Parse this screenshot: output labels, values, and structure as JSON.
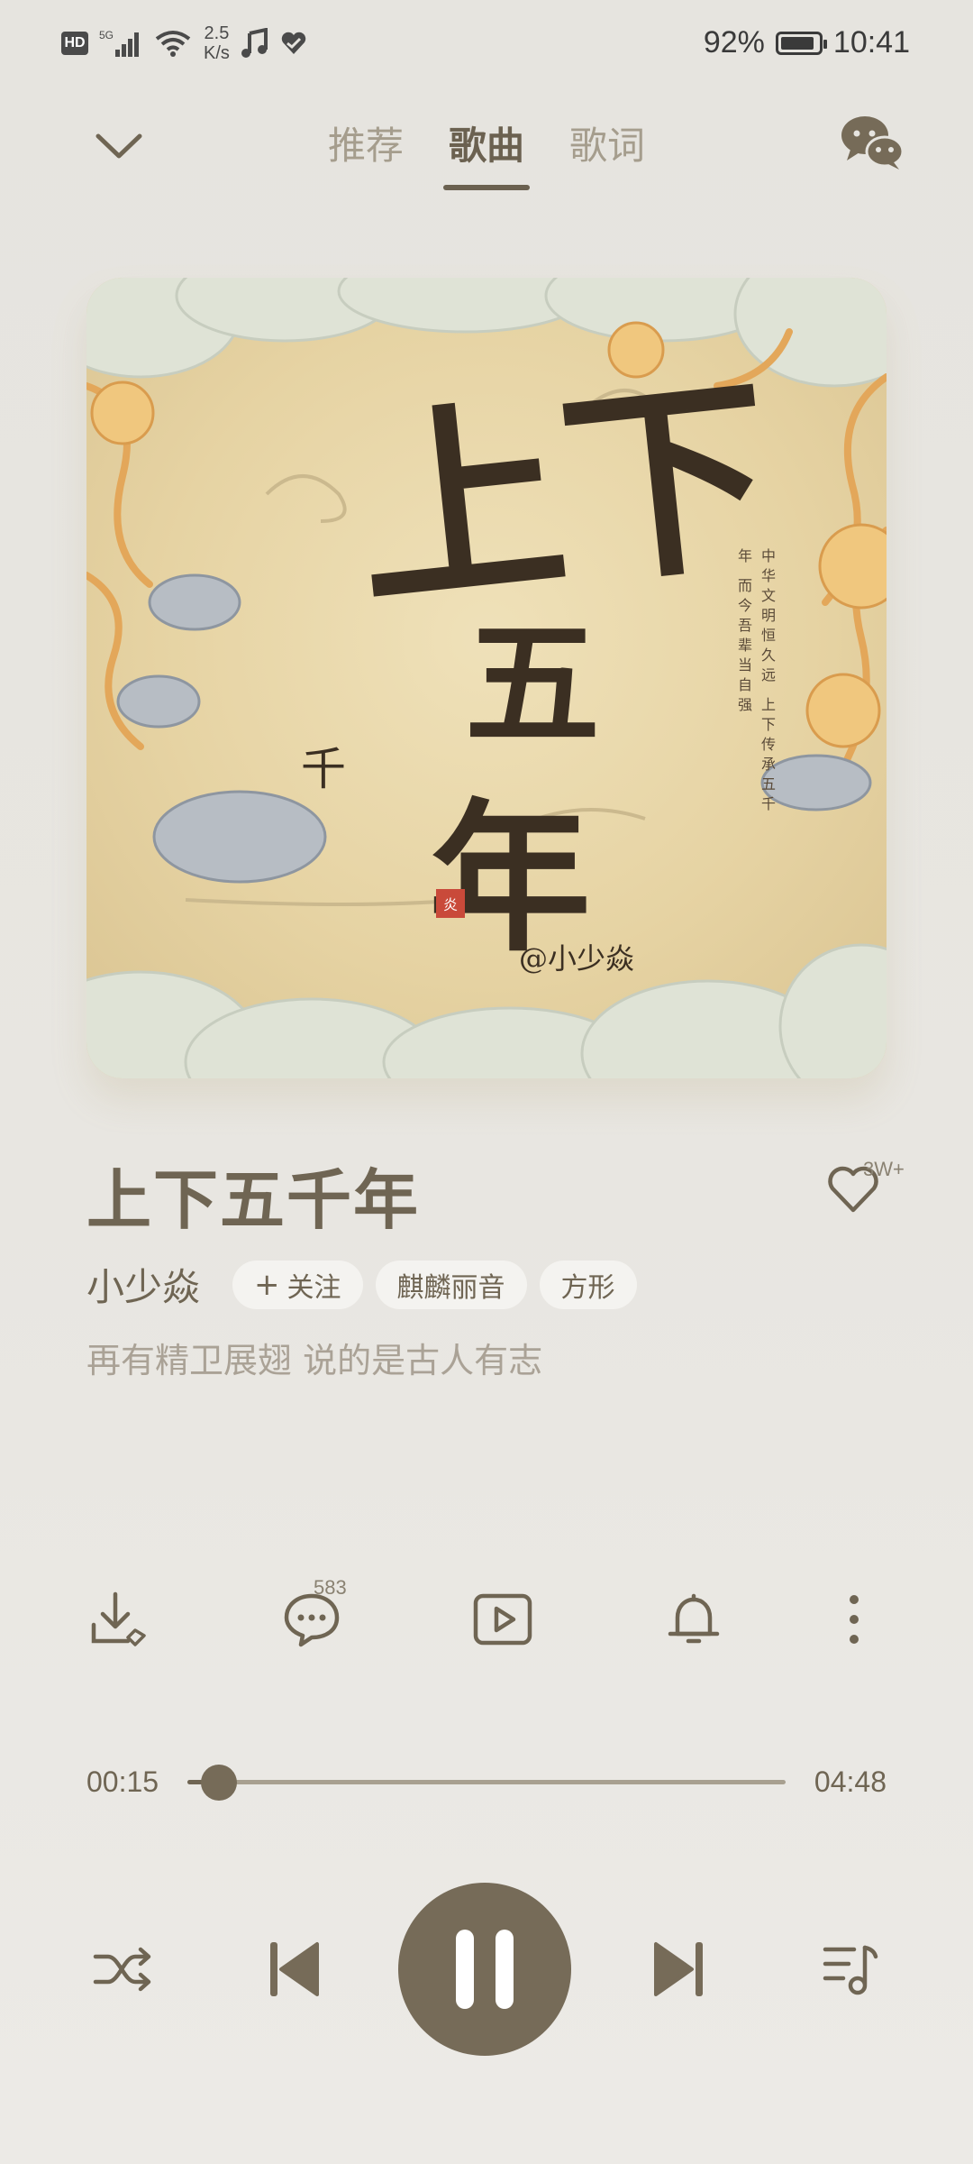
{
  "status_bar": {
    "hd": "HD",
    "network": "5G",
    "speed_value": "2.5",
    "speed_unit": "K/s",
    "battery_percent": "92%",
    "battery_level": 0.92,
    "time": "10:41"
  },
  "nav": {
    "tabs": [
      {
        "label": "推荐",
        "active": false
      },
      {
        "label": "歌曲",
        "active": true
      },
      {
        "label": "歌词",
        "active": false
      }
    ]
  },
  "album_art": {
    "title_line1": "上下",
    "title_line2": "五",
    "title_small": "千",
    "title_line3": "年",
    "seal": "炎",
    "author": "@小少焱",
    "poem": "中华文明恒久远 上下传承五千年 而今吾辈当自强"
  },
  "song": {
    "title": "上下五千年",
    "like_count": "3W+",
    "artist": "小少焱",
    "follow_label": "关注",
    "tags": [
      "麒麟丽音",
      "方形"
    ],
    "lyric": "再有精卫展翅 说的是古人有志"
  },
  "actions": {
    "comment_count": "583"
  },
  "progress": {
    "elapsed": "00:15",
    "total": "04:48",
    "fraction": 0.052
  },
  "colors": {
    "accent": "#766b58",
    "text_primary": "#6f6553",
    "text_muted": "#a59d8d",
    "background": "#e6e4df"
  },
  "icons": {
    "collapse": "chevron-down-icon",
    "share": "wechat-icon",
    "like": "heart-icon",
    "download": "download-icon",
    "comment": "comment-icon",
    "video": "video-play-icon",
    "ringtone": "bell-icon",
    "more": "more-vertical-icon",
    "shuffle": "shuffle-icon",
    "previous": "skip-previous-icon",
    "pause": "pause-icon",
    "next": "skip-next-icon",
    "playlist": "playlist-icon"
  }
}
